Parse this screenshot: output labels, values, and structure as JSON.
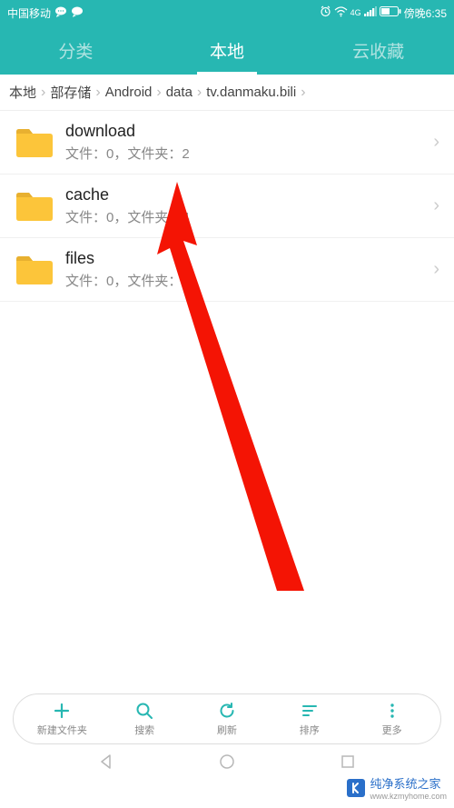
{
  "statusBar": {
    "carrier": "中国移动",
    "time": "傍晚6:35"
  },
  "tabs": {
    "items": [
      {
        "label": "分类",
        "active": false
      },
      {
        "label": "本地",
        "active": true
      },
      {
        "label": "云收藏",
        "active": false
      }
    ]
  },
  "breadcrumb": {
    "items": [
      "本地",
      "部存储",
      "Android",
      "data",
      "tv.danmaku.bili"
    ]
  },
  "files": [
    {
      "name": "download",
      "meta": "文件：0，文件夹：2"
    },
    {
      "name": "cache",
      "meta": "文件：0，文件夹：4"
    },
    {
      "name": "files",
      "meta": "文件：0，文件夹：6"
    }
  ],
  "bottomBar": {
    "items": [
      {
        "icon": "plus",
        "label": "新建文件夹"
      },
      {
        "icon": "search",
        "label": "搜索"
      },
      {
        "icon": "refresh",
        "label": "刷新"
      },
      {
        "icon": "sort",
        "label": "排序"
      },
      {
        "icon": "more",
        "label": "更多"
      }
    ]
  },
  "watermark": {
    "text": "纯净系统之家",
    "url": "www.kzmyhome.com"
  },
  "colors": {
    "accent": "#27b7b2",
    "folder": "#fcc53a",
    "arrow": "#f41404"
  }
}
